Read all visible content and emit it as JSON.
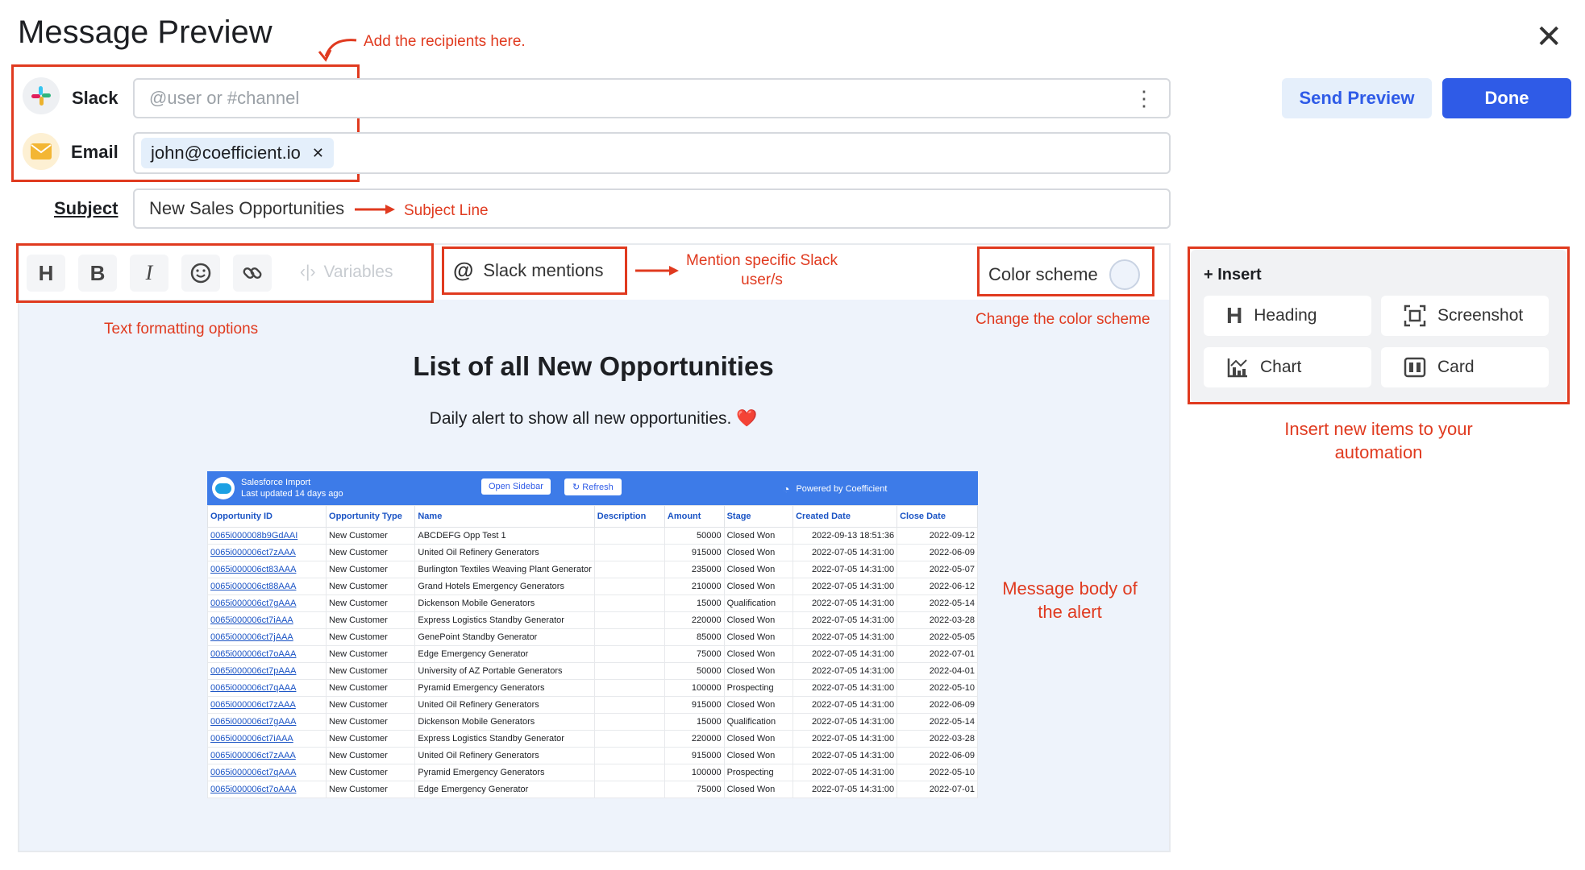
{
  "header": {
    "title": "Message Preview"
  },
  "annotations": {
    "recipients": "Add the recipients here.",
    "subject": "Subject Line",
    "slack_mentions": "Mention specific Slack user/s",
    "text_formatting": "Text formatting options",
    "color_scheme": "Change the color scheme",
    "insert": "Insert new items to your automation",
    "message_body": "Message body of the alert"
  },
  "recipients": {
    "slack_label": "Slack",
    "slack_placeholder": "@user or #channel",
    "email_label": "Email",
    "email_chip": "john@coefficient.io",
    "subject_label": "Subject",
    "subject_value": "New Sales Opportunities"
  },
  "actions": {
    "send_preview": "Send Preview",
    "done": "Done"
  },
  "toolbar": {
    "heading": "H",
    "bold": "B",
    "italic": "I",
    "variables": "Variables",
    "slack_mentions": "Slack mentions",
    "color_scheme": "Color scheme"
  },
  "insert": {
    "title": "+ Insert",
    "items": [
      "Heading",
      "Screenshot",
      "Chart",
      "Card"
    ]
  },
  "message": {
    "heading": "List of all New Opportunities",
    "subtitle": "Daily alert to show all new opportunities. ❤️"
  },
  "sheet": {
    "app_name": "Salesforce Import",
    "last_updated": "Last updated 14 days ago",
    "open_sidebar": "Open Sidebar",
    "refresh": "Refresh",
    "powered_by": "Powered by Coefficient",
    "columns": [
      "Opportunity ID",
      "Opportunity Type",
      "Name",
      "Description",
      "Amount",
      "Stage",
      "Created Date",
      "Close Date"
    ],
    "rows": [
      [
        "0065i000008b9GdAAI",
        "New Customer",
        "ABCDEFG Opp Test 1",
        "",
        "50000",
        "Closed Won",
        "2022-09-13 18:51:36",
        "2022-09-12"
      ],
      [
        "0065i000006ct7zAAA",
        "New Customer",
        "United Oil Refinery Generators",
        "",
        "915000",
        "Closed Won",
        "2022-07-05 14:31:00",
        "2022-06-09"
      ],
      [
        "0065i000006ct83AAA",
        "New Customer",
        "Burlington Textiles Weaving Plant Generator",
        "",
        "235000",
        "Closed Won",
        "2022-07-05 14:31:00",
        "2022-05-07"
      ],
      [
        "0065i000006ct88AAA",
        "New Customer",
        "Grand Hotels Emergency Generators",
        "",
        "210000",
        "Closed Won",
        "2022-07-05 14:31:00",
        "2022-06-12"
      ],
      [
        "0065i000006ct7gAAA",
        "New Customer",
        "Dickenson Mobile Generators",
        "",
        "15000",
        "Qualification",
        "2022-07-05 14:31:00",
        "2022-05-14"
      ],
      [
        "0065i000006ct7iAAA",
        "New Customer",
        "Express Logistics Standby Generator",
        "",
        "220000",
        "Closed Won",
        "2022-07-05 14:31:00",
        "2022-03-28"
      ],
      [
        "0065i000006ct7jAAA",
        "New Customer",
        "GenePoint Standby Generator",
        "",
        "85000",
        "Closed Won",
        "2022-07-05 14:31:00",
        "2022-05-05"
      ],
      [
        "0065i000006ct7oAAA",
        "New Customer",
        "Edge Emergency Generator",
        "",
        "75000",
        "Closed Won",
        "2022-07-05 14:31:00",
        "2022-07-01"
      ],
      [
        "0065i000006ct7pAAA",
        "New Customer",
        "University of AZ Portable Generators",
        "",
        "50000",
        "Closed Won",
        "2022-07-05 14:31:00",
        "2022-04-01"
      ],
      [
        "0065i000006ct7qAAA",
        "New Customer",
        "Pyramid Emergency Generators",
        "",
        "100000",
        "Prospecting",
        "2022-07-05 14:31:00",
        "2022-05-10"
      ],
      [
        "0065i000006ct7zAAA",
        "New Customer",
        "United Oil Refinery Generators",
        "",
        "915000",
        "Closed Won",
        "2022-07-05 14:31:00",
        "2022-06-09"
      ],
      [
        "0065i000006ct7gAAA",
        "New Customer",
        "Dickenson Mobile Generators",
        "",
        "15000",
        "Qualification",
        "2022-07-05 14:31:00",
        "2022-05-14"
      ],
      [
        "0065i000006ct7iAAA",
        "New Customer",
        "Express Logistics Standby Generator",
        "",
        "220000",
        "Closed Won",
        "2022-07-05 14:31:00",
        "2022-03-28"
      ],
      [
        "0065i000006ct7zAAA",
        "New Customer",
        "United Oil Refinery Generators",
        "",
        "915000",
        "Closed Won",
        "2022-07-05 14:31:00",
        "2022-06-09"
      ],
      [
        "0065i000006ct7qAAA",
        "New Customer",
        "Pyramid Emergency Generators",
        "",
        "100000",
        "Prospecting",
        "2022-07-05 14:31:00",
        "2022-05-10"
      ],
      [
        "0065i000006ct7oAAA",
        "New Customer",
        "Edge Emergency Generator",
        "",
        "75000",
        "Closed Won",
        "2022-07-05 14:31:00",
        "2022-07-01"
      ]
    ]
  },
  "colors": {
    "accent": "#2f5be7",
    "annotation": "#e03a1f",
    "panel": "#eef3fb",
    "sheet_header": "#3d7be8"
  }
}
